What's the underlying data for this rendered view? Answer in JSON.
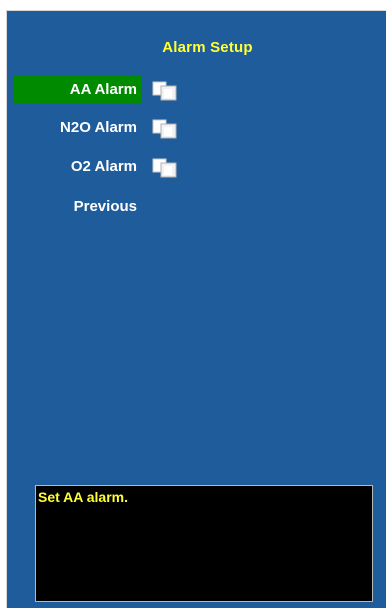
{
  "window": {
    "title": "Alarm Setup"
  },
  "menu": {
    "items": [
      {
        "label": "AA Alarm",
        "selected": true,
        "icon": "submenu-pages-icon"
      },
      {
        "label": "N2O Alarm",
        "selected": false,
        "icon": "submenu-pages-icon"
      },
      {
        "label": "O2 Alarm",
        "selected": false,
        "icon": "submenu-pages-icon"
      },
      {
        "label": "Previous",
        "selected": false
      }
    ]
  },
  "help": {
    "text": "Set AA alarm."
  },
  "colors": {
    "background": "#1f5c9c",
    "title": "#ffff33",
    "selected_item": "#008a00",
    "item_text": "#ffffff",
    "help_background": "#000000",
    "help_text": "#ffff33"
  }
}
